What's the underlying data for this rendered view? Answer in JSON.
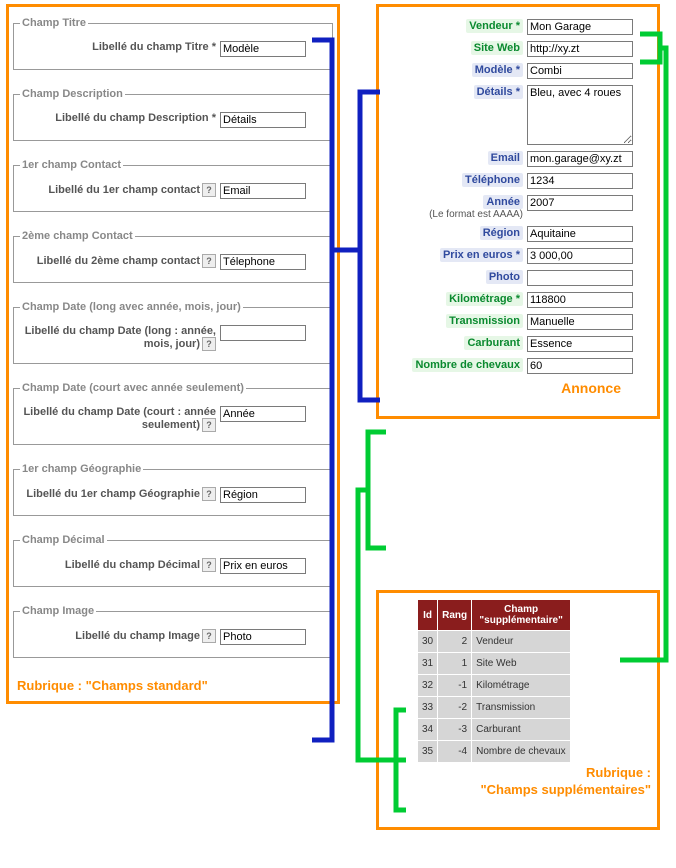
{
  "left": {
    "caption": "Rubrique : \"Champs standard\"",
    "groups": [
      {
        "legend": "Champ Titre",
        "label": "Libellé du champ Titre *",
        "value": "Modèle",
        "help": false
      },
      {
        "legend": "Champ Description",
        "label": "Libellé du champ Description *",
        "value": "Détails",
        "help": false
      },
      {
        "legend": "1er champ Contact",
        "label": "Libellé du 1er champ contact",
        "value": "Email",
        "help": true
      },
      {
        "legend": "2ème champ Contact",
        "label": "Libellé du 2ème champ contact",
        "value": "Télephone",
        "help": true
      },
      {
        "legend": "Champ Date (long avec année, mois, jour)",
        "label": "Libellé du champ Date (long : année, mois, jour)",
        "value": "",
        "help": true
      },
      {
        "legend": "Champ Date (court avec année seulement)",
        "label": "Libellé du champ Date (court : année seulement)",
        "value": "Année",
        "help": true
      },
      {
        "legend": "1er champ Géographie",
        "label": "Libellé du 1er champ Géographie",
        "value": "Région",
        "help": true
      },
      {
        "legend": "Champ Décimal",
        "label": "Libellé du champ Décimal",
        "value": "Prix en euros",
        "help": true
      },
      {
        "legend": "Champ Image",
        "label": "Libellé du champ Image",
        "value": "Photo",
        "help": true
      }
    ]
  },
  "annonce": {
    "caption": "Annonce",
    "fields": [
      {
        "label": "Vendeur *",
        "value": "Mon Garage",
        "style": "green",
        "type": "text"
      },
      {
        "label": "Site Web",
        "value": "http://xy.zt",
        "style": "green",
        "type": "text"
      },
      {
        "label": "Modèle *",
        "value": "Combi",
        "style": "blue",
        "type": "text"
      },
      {
        "label": "Détails *",
        "value": "Bleu, avec 4 roues",
        "style": "blue",
        "type": "textarea"
      },
      {
        "label": "Email",
        "value": "mon.garage@xy.zt",
        "style": "blue",
        "type": "text"
      },
      {
        "label": "Téléphone",
        "value": "1234",
        "style": "blue",
        "type": "text"
      },
      {
        "label": "Année",
        "sublabel": "(Le format est AAAA)",
        "value": "2007",
        "style": "blue",
        "type": "text"
      },
      {
        "label": "Région",
        "value": "Aquitaine",
        "style": "blue",
        "type": "text"
      },
      {
        "label": "Prix en euros *",
        "value": "3 000,00",
        "style": "blue",
        "type": "text"
      },
      {
        "label": "Photo",
        "value": "",
        "style": "blue",
        "type": "text"
      },
      {
        "label": "Kilométrage *",
        "value": "118800",
        "style": "green",
        "type": "text"
      },
      {
        "label": "Transmission",
        "value": "Manuelle",
        "style": "green",
        "type": "text"
      },
      {
        "label": "Carburant",
        "value": "Essence",
        "style": "green",
        "type": "text"
      },
      {
        "label": "Nombre de chevaux",
        "value": "60",
        "style": "green",
        "type": "text"
      }
    ]
  },
  "table": {
    "caption": "Rubrique : \"Champs supplémentaires\"",
    "headers": [
      "Id",
      "Rang",
      "Champ \"supplémentaire\""
    ],
    "rows": [
      {
        "id": "30",
        "rank": "2",
        "name": "Vendeur"
      },
      {
        "id": "31",
        "rank": "1",
        "name": "Site Web"
      },
      {
        "id": "32",
        "rank": "-1",
        "name": "Kilométrage"
      },
      {
        "id": "33",
        "rank": "-2",
        "name": "Transmission"
      },
      {
        "id": "34",
        "rank": "-3",
        "name": "Carburant"
      },
      {
        "id": "35",
        "rank": "-4",
        "name": "Nombre de chevaux"
      }
    ]
  }
}
